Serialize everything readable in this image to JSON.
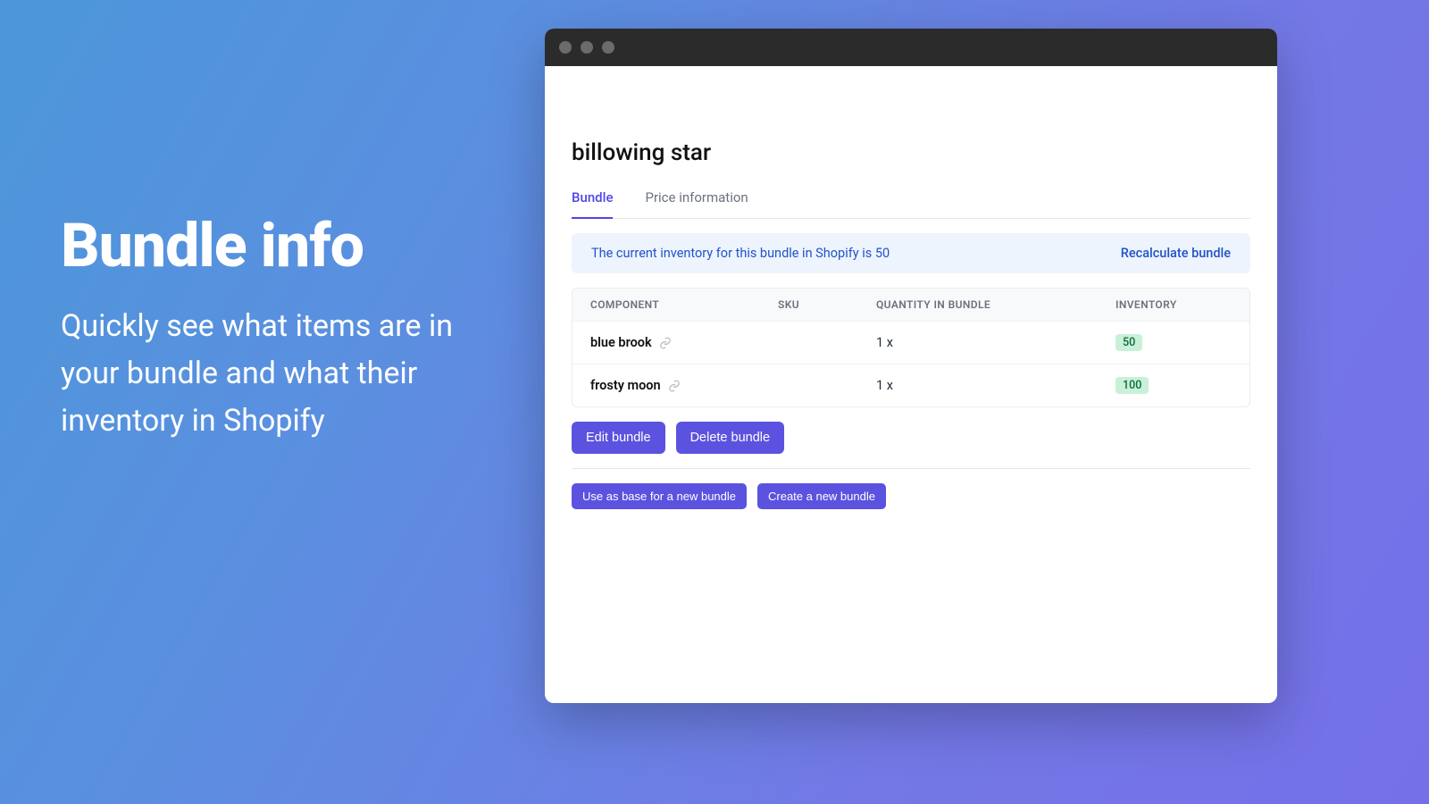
{
  "hero": {
    "title": "Bundle info",
    "subtitle": "Quickly see what items are in your bundle and what their inventory in Shopify"
  },
  "page": {
    "title": "billowing star",
    "tabs": [
      {
        "label": "Bundle",
        "active": true
      },
      {
        "label": "Price information",
        "active": false
      }
    ],
    "banner": {
      "text": "The current inventory for this bundle in Shopify is 50",
      "action": "Recalculate bundle"
    },
    "table": {
      "headers": {
        "component": "COMPONENT",
        "sku": "SKU",
        "quantity": "QUANTITY IN BUNDLE",
        "inventory": "INVENTORY"
      },
      "rows": [
        {
          "name": "blue brook",
          "sku": "",
          "qty": "1 x",
          "inventory": "50"
        },
        {
          "name": "frosty moon",
          "sku": "",
          "qty": "1 x",
          "inventory": "100"
        }
      ]
    },
    "actions": {
      "edit": "Edit bundle",
      "delete": "Delete bundle",
      "use_as_base": "Use as base for a new bundle",
      "create_new": "Create a new bundle"
    }
  }
}
